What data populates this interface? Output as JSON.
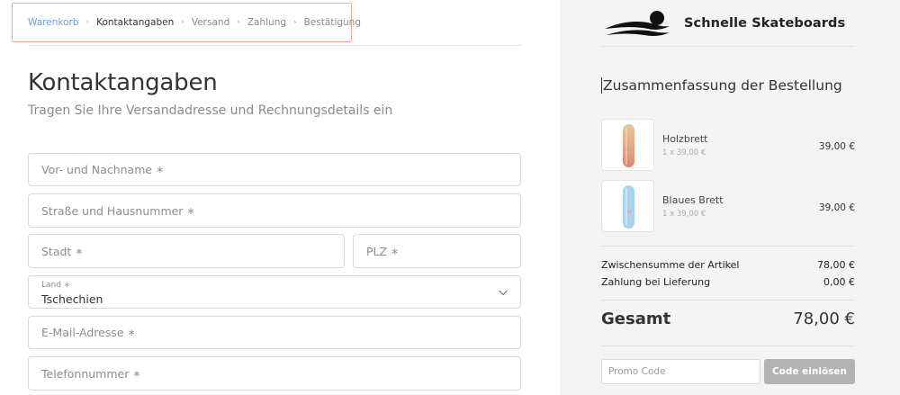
{
  "breadcrumb": {
    "items": [
      {
        "label": "Warenkorb"
      },
      {
        "label": "Kontaktangaben"
      },
      {
        "label": "Versand"
      },
      {
        "label": "Zahlung"
      },
      {
        "label": "Bestätigung"
      }
    ],
    "separator": "›"
  },
  "main": {
    "title": "Kontaktangaben",
    "subtitle": "Tragen Sie Ihre Versandadresse und Rechnungsdetails ein"
  },
  "form": {
    "required_mark": "∗",
    "name_placeholder": "Vor- und Nachname",
    "street_placeholder": "Straße und Hausnummer",
    "city_placeholder": "Stadt",
    "zip_placeholder": "PLZ",
    "country_label": "Land",
    "country_value": "Tschechien",
    "email_placeholder": "E-Mail-Adresse",
    "phone_placeholder": "Telefonnummer"
  },
  "brand": {
    "name": "Schnelle Skateboards"
  },
  "summary": {
    "title": "Zusammenfassung der Bestellung",
    "items": [
      {
        "name": "Holzbrett",
        "qty": "1 x 39,00 €",
        "price": "39,00 €"
      },
      {
        "name": "Blaues Brett",
        "qty": "1 x 39,00 €",
        "price": "39,00 €"
      }
    ],
    "subtotal_label": "Zwischensumme der Artikel",
    "subtotal_value": "78,00 €",
    "payment_label": "Zahlung bei Lieferung",
    "payment_value": "0,00 €",
    "total_label": "Gesamt",
    "total_value": "78,00 €"
  },
  "promo": {
    "placeholder": "Promo Code",
    "button_label": "Code einlösen"
  },
  "colors": {
    "breadcrumb_link": "#6a9fd8",
    "highlight_border": "#f0a8a8",
    "sidebar_bg": "#f4f4f4",
    "button_bg": "#b3b3b3"
  },
  "icons": [
    "chevron-down-icon",
    "skateboarder-logo-icon"
  ]
}
